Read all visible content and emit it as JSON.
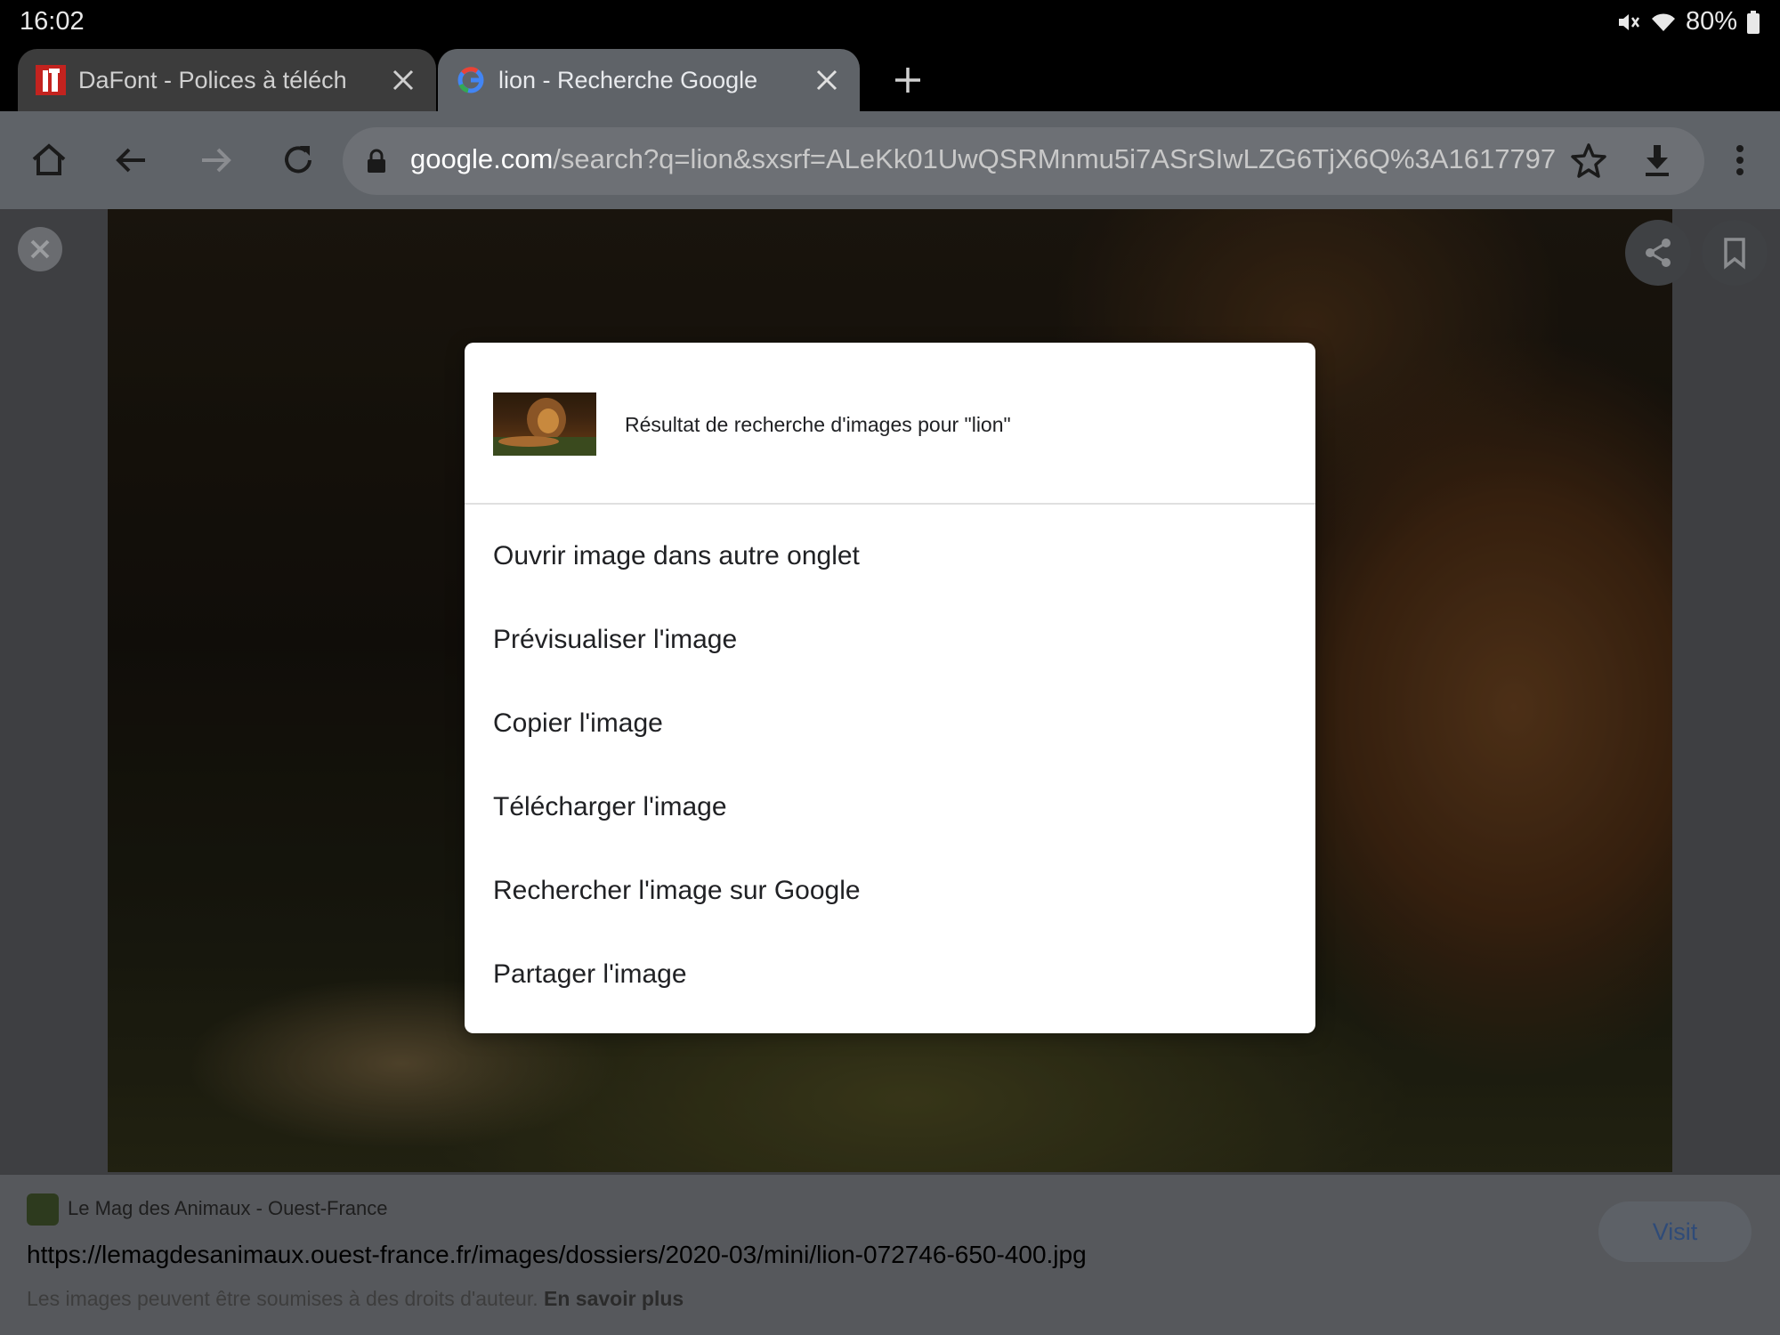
{
  "status_bar": {
    "time": "16:02",
    "battery": "80%"
  },
  "tabs": [
    {
      "title": "DaFont - Polices à télécharg",
      "active": false
    },
    {
      "title": "lion - Recherche Google",
      "active": true
    }
  ],
  "toolbar": {
    "url_host": "google.com",
    "url_path": "/search?q=lion&sxsrf=ALeKk01UwQSRMnmu5i7ASrSIwLZG6TjX6Q%3A1617797"
  },
  "dialog": {
    "title": "Résultat de recherche d'images pour \"lion\"",
    "menu": [
      "Ouvrir image dans autre onglet",
      "Prévisualiser l'image",
      "Copier l'image",
      "Télécharger l'image",
      "Rechercher l'image sur Google",
      "Partager l'image"
    ]
  },
  "info": {
    "source": "Le Mag des Animaux - Ouest-France",
    "url": "https://lemagdesanimaux.ouest-france.fr/images/dossiers/2020-03/mini/lion-072746-650-400.jpg",
    "copyright": "Les images peuvent être soumises à des droits d'auteur.",
    "learn_more": "En savoir plus",
    "visit": "Visit"
  },
  "colors": {
    "omnibox": "#6d7075",
    "toolbar": "#5f6368",
    "dialog": "#ffffff"
  }
}
